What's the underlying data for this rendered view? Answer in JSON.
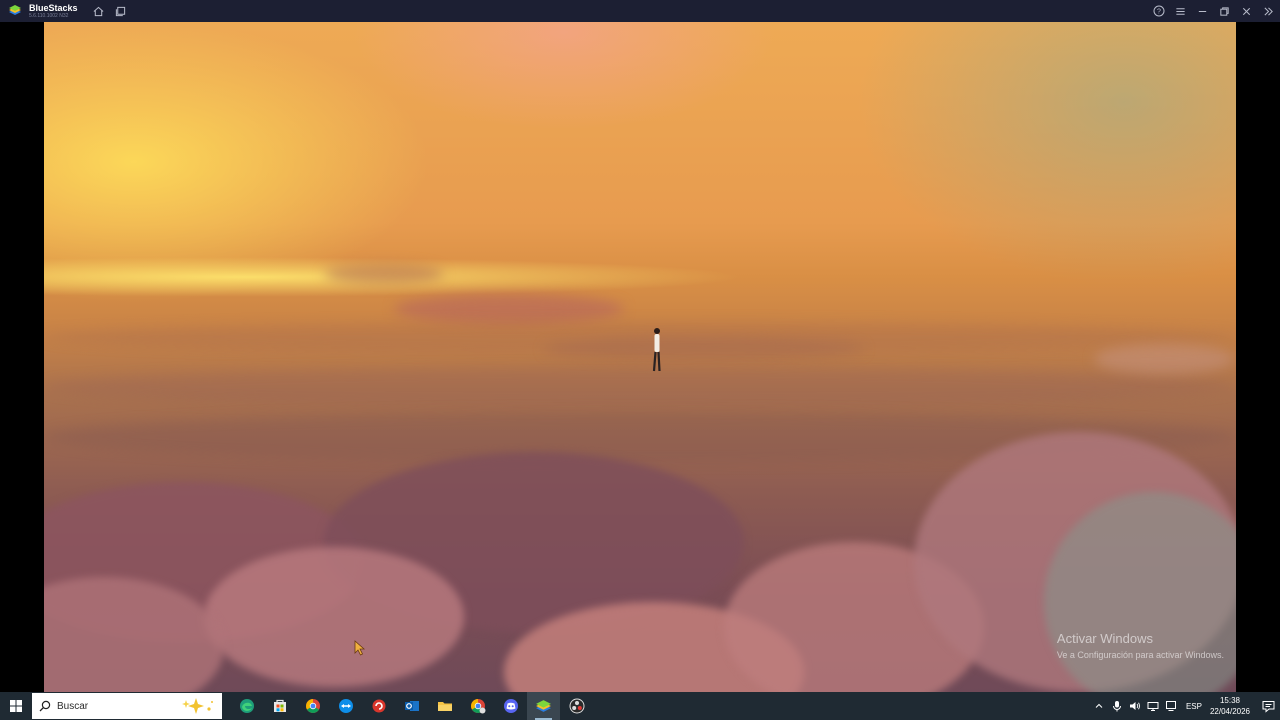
{
  "window": {
    "app_name": "BlueStacks",
    "version": "5.6.110.1002 N32"
  },
  "icons": {
    "logo": "bluestacks-logo-icon",
    "home": "home-icon",
    "multi_instance": "multi-instance-icon",
    "help": "help-icon",
    "menu": "hamburger-menu-icon",
    "minimize": "minimize-icon",
    "restore": "restore-icon",
    "close": "close-icon",
    "sidebar": "sidebar-toggle-icon"
  },
  "watermark": {
    "line1": "Activar Windows",
    "line2": "Ve a Configuración para activar Windows."
  },
  "taskbar": {
    "search_placeholder": "Buscar",
    "apps": [
      {
        "name": "edge-icon"
      },
      {
        "name": "microsoft-store-icon"
      },
      {
        "name": "chrome-icon"
      },
      {
        "name": "teamviewer-icon"
      },
      {
        "name": "red-app-icon"
      },
      {
        "name": "outlook-icon"
      },
      {
        "name": "file-explorer-icon"
      },
      {
        "name": "chrome-alt-icon"
      },
      {
        "name": "discord-icon"
      },
      {
        "name": "bluestacks-icon",
        "active": true
      },
      {
        "name": "obs-icon"
      }
    ],
    "tray": {
      "language": "ESP",
      "time": "15:38",
      "date": "22/04/2026"
    }
  },
  "colors": {
    "titlebar_bg": "#1c1f33",
    "taskbar_bg": "#1f2a33"
  }
}
